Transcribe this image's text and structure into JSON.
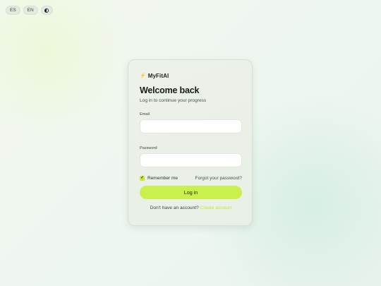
{
  "top_controls": {
    "lang_es": "ES",
    "lang_en": "EN",
    "theme_icon": "half-circle-icon"
  },
  "brand": {
    "icon": "bolt-icon",
    "name": "MyFitAI",
    "accent": "#c6e63a"
  },
  "login": {
    "title": "Welcome back",
    "subtitle": "Log in to continue your progress",
    "email_label": "Email",
    "email_value": "",
    "password_label": "Password",
    "password_value": "",
    "remember_label": "Remember me",
    "remember_checked": true,
    "forgot_label": "Forgot your password?",
    "submit_label": "Log in",
    "no_account_text": "Don't have an account?",
    "create_account_label": "Create account"
  },
  "colors": {
    "button": "#cbef4c",
    "card": "#eaf0e8"
  }
}
